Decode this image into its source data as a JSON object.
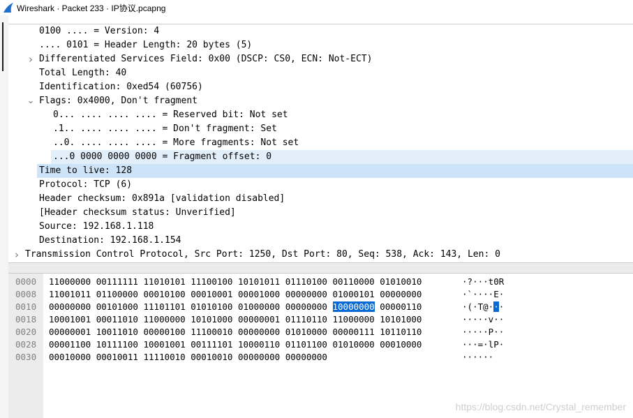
{
  "window": {
    "title": "Wireshark · Packet 233 · IP协议.pcapng"
  },
  "detail_rows": [
    {
      "text": "0100 .... = Version: 4",
      "indent": 0,
      "expander": "none",
      "state": "normal"
    },
    {
      "text": ".... 0101 = Header Length: 20 bytes (5)",
      "indent": 0,
      "expander": "none",
      "state": "normal"
    },
    {
      "text": "Differentiated Services Field: 0x00 (DSCP: CS0, ECN: Not-ECT)",
      "indent": 0,
      "expander": "collapsed",
      "state": "normal"
    },
    {
      "text": "Total Length: 40",
      "indent": 0,
      "expander": "none",
      "state": "normal"
    },
    {
      "text": "Identification: 0xed54 (60756)",
      "indent": 0,
      "expander": "none",
      "state": "normal"
    },
    {
      "text": "Flags: 0x4000, Don't fragment",
      "indent": 0,
      "expander": "expanded",
      "state": "normal"
    },
    {
      "text": "0... .... .... .... = Reserved bit: Not set",
      "indent": 1,
      "expander": "none",
      "state": "normal"
    },
    {
      "text": ".1.. .... .... .... = Don't fragment: Set",
      "indent": 1,
      "expander": "none",
      "state": "normal"
    },
    {
      "text": "..0. .... .... .... = More fragments: Not set",
      "indent": 1,
      "expander": "none",
      "state": "normal"
    },
    {
      "text": "...0 0000 0000 0000 = Fragment offset: 0",
      "indent": 1,
      "expander": "none",
      "state": "related"
    },
    {
      "text": "Time to live: 128",
      "indent": 0,
      "expander": "none",
      "state": "selected"
    },
    {
      "text": "Protocol: TCP (6)",
      "indent": 0,
      "expander": "none",
      "state": "normal"
    },
    {
      "text": "Header checksum: 0x891a [validation disabled]",
      "indent": 0,
      "expander": "none",
      "state": "normal"
    },
    {
      "text": "[Header checksum status: Unverified]",
      "indent": 0,
      "expander": "none",
      "state": "normal"
    },
    {
      "text": "Source: 192.168.1.118",
      "indent": 0,
      "expander": "none",
      "state": "normal"
    },
    {
      "text": "Destination: 192.168.1.154",
      "indent": 0,
      "expander": "none",
      "state": "normal"
    },
    {
      "text": "Transmission Control Protocol, Src Port: 1250, Dst Port: 80, Seq: 538, Ack: 143, Len: 0",
      "indent": -1,
      "expander": "collapsed",
      "state": "normal"
    }
  ],
  "byte_rows": [
    {
      "offset": "0000",
      "bytes": [
        "11000000",
        "00111111",
        "11010101",
        "11100100",
        "10101011",
        "01110100",
        "00110000",
        "01010010"
      ],
      "ascii": "·?···t0R",
      "hl_byte": -1,
      "hl_char": -1
    },
    {
      "offset": "0008",
      "bytes": [
        "11001011",
        "01100000",
        "00010100",
        "00010001",
        "00001000",
        "00000000",
        "01000101",
        "00000000"
      ],
      "ascii": "·`····E·",
      "hl_byte": -1,
      "hl_char": -1
    },
    {
      "offset": "0010",
      "bytes": [
        "00000000",
        "00101000",
        "11101101",
        "01010100",
        "01000000",
        "00000000",
        "10000000",
        "00000110"
      ],
      "ascii": "·(·T@···",
      "hl_byte": 6,
      "hl_char": 6
    },
    {
      "offset": "0018",
      "bytes": [
        "10001001",
        "00011010",
        "11000000",
        "10101000",
        "00000001",
        "01110110",
        "11000000",
        "10101000"
      ],
      "ascii": "·····v··",
      "hl_byte": -1,
      "hl_char": -1
    },
    {
      "offset": "0020",
      "bytes": [
        "00000001",
        "10011010",
        "00000100",
        "11100010",
        "00000000",
        "01010000",
        "00000111",
        "10110110"
      ],
      "ascii": "·····P··",
      "hl_byte": -1,
      "hl_char": -1
    },
    {
      "offset": "0028",
      "bytes": [
        "00001100",
        "10111100",
        "10001001",
        "00111101",
        "10000110",
        "01101100",
        "01010000",
        "00010000"
      ],
      "ascii": "···=·lP·",
      "hl_byte": -1,
      "hl_char": -1
    },
    {
      "offset": "0030",
      "bytes": [
        "00010000",
        "00010011",
        "11110010",
        "00010010",
        "00000000",
        "00000000"
      ],
      "ascii": "······",
      "hl_byte": -1,
      "hl_char": -1
    }
  ],
  "watermark": "https://blog.csdn.net/Crystal_remember",
  "icons": {
    "app": "wireshark-fin-icon",
    "collapsed": "chevron-right-icon",
    "expanded": "chevron-down-icon"
  },
  "colors": {
    "selected_row": "#cde3f8",
    "related_row": "#e3eefb",
    "byte_highlight": "#0a6ad4",
    "fin_blue": "#1f6fcf"
  }
}
